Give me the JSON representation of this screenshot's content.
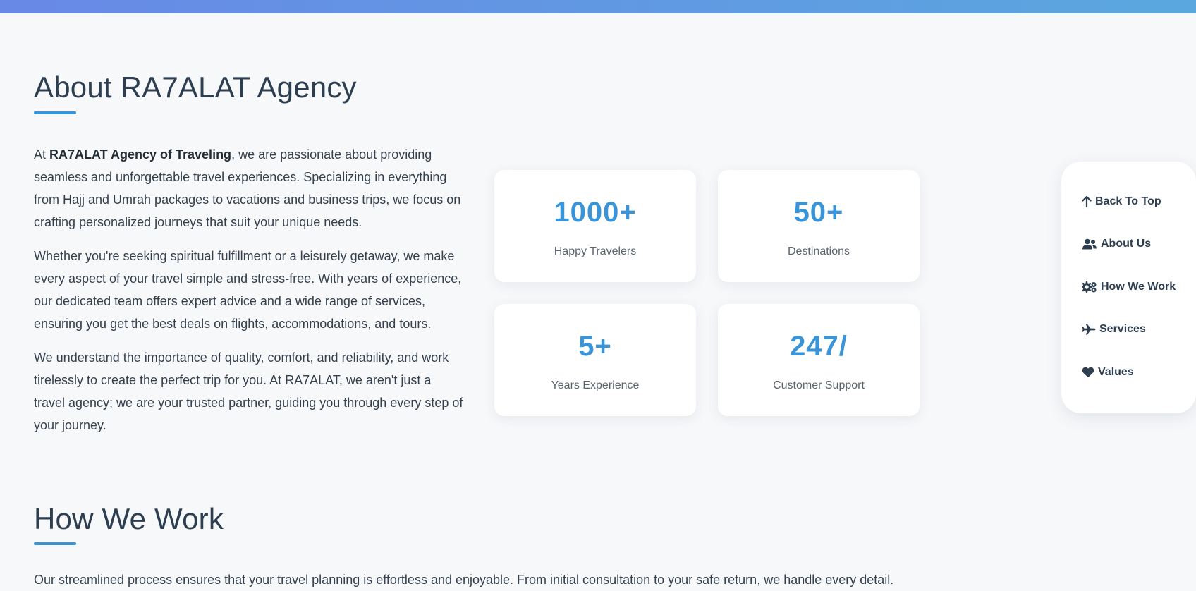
{
  "colors": {
    "accent": "#3a94d8",
    "heading": "#2c3e50",
    "background": "#f7f8fa",
    "top_bar_start": "#6889e6",
    "top_bar_end": "#5aa7df"
  },
  "about": {
    "title": "About RA7ALAT Agency",
    "p1_prefix": "At ",
    "p1_bold": "RA7ALAT Agency of Traveling",
    "p1_rest": ", we are passionate about providing seamless and unforgettable travel experiences. Specializing in everything from Hajj and Umrah packages to vacations and business trips, we focus on crafting personalized journeys that suit your unique needs.",
    "p2": "Whether you're seeking spiritual fulfillment or a leisurely getaway, we make every aspect of your travel simple and stress-free. With years of experience, our dedicated team offers expert advice and a wide range of services, ensuring you get the best deals on flights, accommodations, and tours.",
    "p3": "We understand the importance of quality, comfort, and reliability, and work tirelessly to create the perfect trip for you. At RA7ALAT, we aren't just a travel agency; we are your trusted partner, guiding you through every step of your journey."
  },
  "stats": [
    {
      "number": "1000+",
      "label": "Happy Travelers"
    },
    {
      "number": "50+",
      "label": "Destinations"
    },
    {
      "number": "5+",
      "label": "Years Experience"
    },
    {
      "number": "247/",
      "label": "Customer Support"
    }
  ],
  "side_nav": {
    "items": [
      {
        "label": "Back To Top",
        "icon": "arrow-up-icon"
      },
      {
        "label": "About Us",
        "icon": "users-icon"
      },
      {
        "label": "How We Work",
        "icon": "gears-icon"
      },
      {
        "label": "Services",
        "icon": "plane-icon"
      },
      {
        "label": "Values",
        "icon": "heart-icon"
      }
    ]
  },
  "how_we_work": {
    "title": "How We Work",
    "intro": "Our streamlined process ensures that your travel planning is effortless and enjoyable. From initial consultation to your safe return, we handle every detail."
  }
}
